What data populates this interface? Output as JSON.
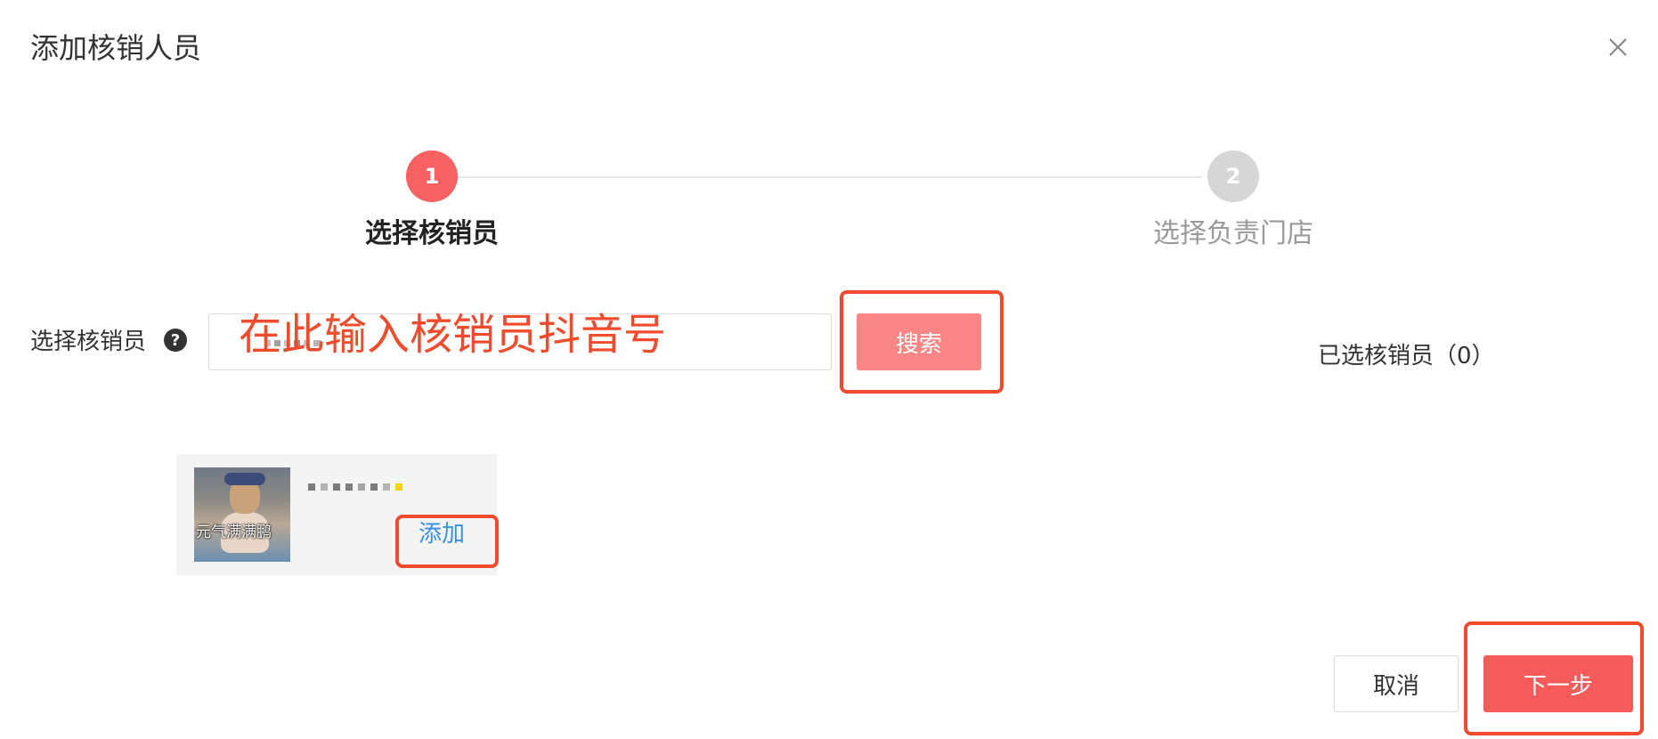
{
  "dialog": {
    "title": "添加核销人员",
    "close_icon": "close-icon"
  },
  "steps": [
    {
      "number": "1",
      "label": "选择核销员",
      "status": "active"
    },
    {
      "number": "2",
      "label": "选择负责门店",
      "status": "pending"
    }
  ],
  "form": {
    "label": "选择核销员",
    "help_icon": "question-circle-icon",
    "help_glyph": "?",
    "search_button": "搜索",
    "selected_count_label": "已选核销员（0）"
  },
  "result": {
    "avatar_caption": "元气满满鹏",
    "add_link": "添加"
  },
  "footer": {
    "cancel_label": "取消",
    "next_label": "下一步"
  },
  "annotations": {
    "input_hint": "在此输入核销员抖音号",
    "color": "#f04b2c"
  },
  "colors": {
    "primary": "#f65b5b",
    "search_button": "#f98585",
    "link": "#3a8ee6",
    "step_pending": "#d6d6d6"
  }
}
